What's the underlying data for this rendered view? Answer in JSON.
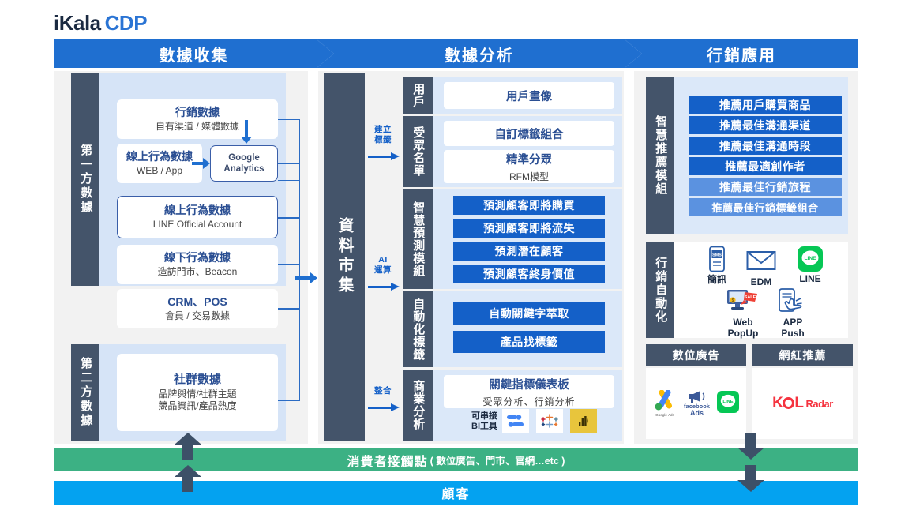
{
  "logo": {
    "primary": "iKala",
    "secondary": "CDP"
  },
  "stages": [
    {
      "id": "collect",
      "title": "數據收集"
    },
    {
      "id": "analyze",
      "title": "數據分析"
    },
    {
      "id": "activate",
      "title": "行銷應用"
    }
  ],
  "collect": {
    "groups": [
      {
        "label": "第一方數據",
        "cards": [
          {
            "title": "行銷數據",
            "sub": "自有渠道 / 媒體數據"
          },
          {
            "title": "線上行為數據",
            "sub": "WEB / App"
          },
          {
            "title": "Google Analytics",
            "sub": ""
          },
          {
            "title": "線上行為數據",
            "sub": "LINE Official Account"
          },
          {
            "title": "線下行為數據",
            "sub": "造訪門市、Beacon"
          },
          {
            "title": "CRM、POS",
            "sub": "會員 / 交易數據"
          }
        ]
      },
      {
        "label": "第二方數據",
        "cards": [
          {
            "title": "社群數據",
            "sub": "品牌輿情/社群主題",
            "sub2": "競品資訊/產品熱度"
          }
        ]
      }
    ]
  },
  "market": {
    "label": "資料市集"
  },
  "flow_arrows": [
    {
      "caption": "建立\n標籤",
      "line1": "建立",
      "line2": "標籤"
    },
    {
      "caption": "AI 運算",
      "line1": "AI",
      "line2": "運算"
    },
    {
      "caption": "整合",
      "line1": "整合",
      "line2": ""
    }
  ],
  "analyze": {
    "sections": [
      {
        "label": "用戶",
        "items": [
          {
            "text": "用戶畫像",
            "style": "white"
          }
        ]
      },
      {
        "label": "受眾名單",
        "items": [
          {
            "text": "自訂標籤組合",
            "style": "white"
          },
          {
            "text": "精準分眾",
            "sub": "RFM模型",
            "style": "white"
          }
        ]
      },
      {
        "label": "智慧預測模組",
        "items": [
          {
            "text": "預測顧客即將購買",
            "style": "blue"
          },
          {
            "text": "預測顧客即將流失",
            "style": "blue"
          },
          {
            "text": "預測潛在顧客",
            "style": "blue"
          },
          {
            "text": "預測顧客終身價值",
            "style": "blue"
          }
        ]
      },
      {
        "label": "自動化標籤",
        "items": [
          {
            "text": "自動關鍵字萃取",
            "style": "blue"
          },
          {
            "text": "產品找標籤",
            "style": "blue"
          }
        ]
      },
      {
        "label": "商業分析",
        "items": [
          {
            "text": "關鍵指標儀表板",
            "sub": "受眾分析、行銷分析",
            "style": "white"
          }
        ],
        "bi_label_line1": "可串接",
        "bi_label_line2": "BI工具",
        "bi_tools": [
          "looker-studio",
          "tableau",
          "power-bi"
        ]
      }
    ]
  },
  "activate": {
    "reco": {
      "label": "智慧推薦模組",
      "items": [
        {
          "text": "推薦用戶購買商品",
          "style": "blue"
        },
        {
          "text": "推薦最佳溝通渠道",
          "style": "blue"
        },
        {
          "text": "推薦最佳溝通時段",
          "style": "blue"
        },
        {
          "text": "推薦最適創作者",
          "style": "blue"
        },
        {
          "text": "推薦最佳行銷旅程",
          "style": "light"
        },
        {
          "text": "推薦最佳行銷標籤組合",
          "style": "light"
        }
      ]
    },
    "automation": {
      "label": "行銷自動化",
      "channels": [
        {
          "icon": "sms-icon",
          "label": "簡訊"
        },
        {
          "icon": "email-icon",
          "label": "EDM"
        },
        {
          "icon": "line-icon",
          "label": "LINE"
        },
        {
          "icon": "webpopup-icon",
          "label": "Web PopUp",
          "l1": "Web",
          "l2": "PopUp"
        },
        {
          "icon": "apppush-icon",
          "label": "APP Push",
          "l1": "APP",
          "l2": "Push"
        }
      ]
    },
    "panels": [
      {
        "title": "數位廣告",
        "logos": [
          "google-ads-logo",
          "facebook-ads-logo",
          "line-logo"
        ]
      },
      {
        "title": "網紅推薦",
        "logos": [
          "kol-radar-logo"
        ]
      }
    ]
  },
  "footer": {
    "touchpoint_main": "消費者接觸點",
    "touchpoint_sub": "( 數位廣告、門市、官網…etc )",
    "customer": "顧客"
  },
  "colors": {
    "brand_blue": "#1f6fd0",
    "deep_blue": "#1460c8",
    "light_blue": "#5b92e0",
    "slate": "#44546a",
    "pale": "#d6e4f7",
    "green": "#3cb184",
    "cyan": "#04a2f0",
    "kol_red": "#f5333f"
  }
}
